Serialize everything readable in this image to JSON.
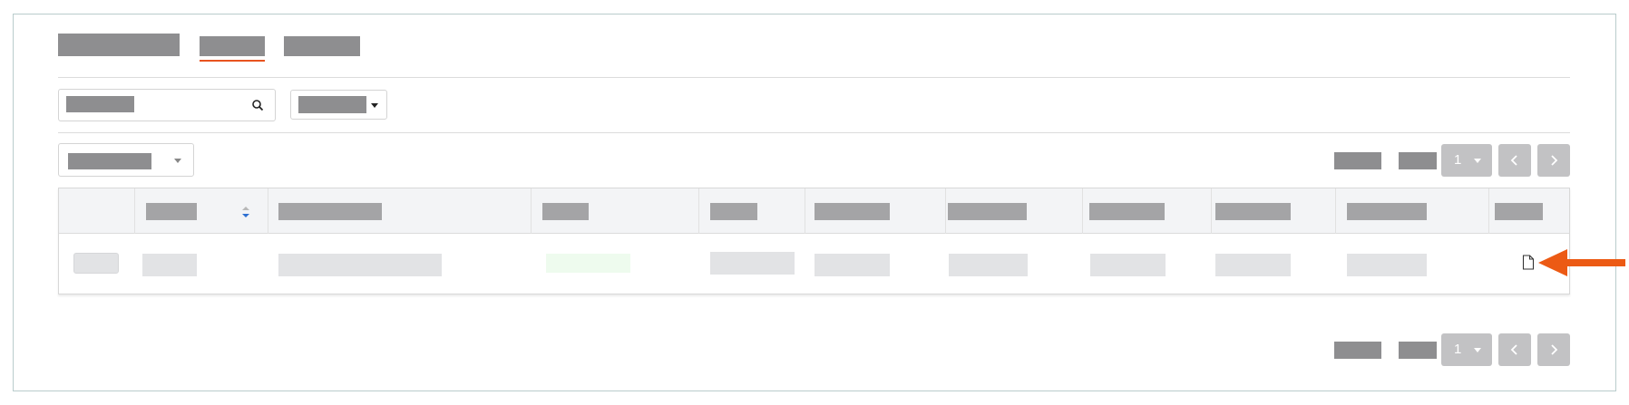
{
  "pagination_top": {
    "current_page": "1"
  },
  "pagination_bottom": {
    "current_page": "1"
  },
  "icons": {
    "search": "search-icon",
    "filter_caret": "caret-down-icon",
    "sort": "sort-icon",
    "row_action": "document-icon",
    "prev": "chevron-left-icon",
    "next": "chevron-right-icon",
    "annotation": "arrow-left-icon"
  },
  "colors": {
    "tab_active_underline": "#e8531f",
    "annotation_arrow": "#ec5a14",
    "pagination_button": "#c2c2c4",
    "table_header_bg": "#f3f4f6",
    "frame_border": "#b9cccc"
  }
}
